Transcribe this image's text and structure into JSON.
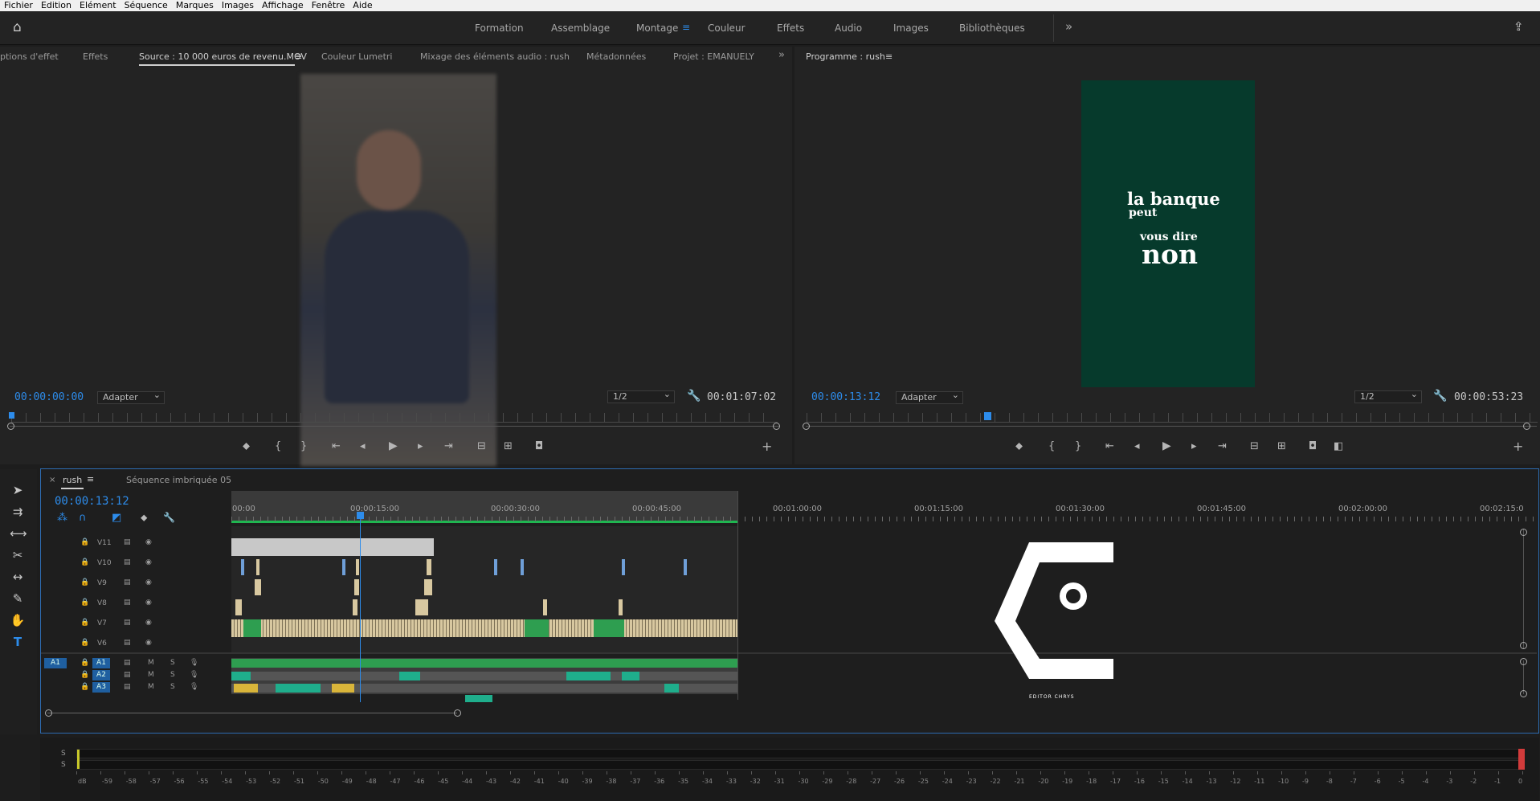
{
  "menu": [
    "Fichier",
    "Edition",
    "Elément",
    "Séquence",
    "Marques",
    "Images",
    "Affichage",
    "Fenêtre",
    "Aide"
  ],
  "workspaces": {
    "items": [
      "Formation",
      "Assemblage",
      "Montage",
      "Couleur",
      "Effets",
      "Audio",
      "Images",
      "Bibliothèques"
    ],
    "active": "Montage",
    "more": "»"
  },
  "source_panel": {
    "tabs": [
      "ptions d'effet",
      "Effets",
      "Source : 10 000 euros de revenu.MOV",
      "Couleur Lumetri",
      "Mixage des éléments audio : rush",
      "Métadonnées",
      "Projet : EMANUELY"
    ],
    "timecode": "00:00:00:00",
    "fit": "Adapter",
    "resolution": "1/2",
    "duration": "00:01:07:02"
  },
  "program_panel": {
    "title": "Programme : rush",
    "timecode": "00:00:13:12",
    "fit": "Adapter",
    "resolution": "1/2",
    "duration": "00:00:53:23",
    "caption": {
      "line1": "la banque",
      "line2": "peut",
      "line3": "vous dire",
      "line4": "non"
    }
  },
  "timeline": {
    "tabs": [
      "rush",
      "Séquence imbriquée 05"
    ],
    "timecode": "00:00:13:12",
    "ruler": [
      "00:00",
      "00:00:15:00",
      "00:00:30:00",
      "00:00:45:00",
      "00:01:00:00",
      "00:01:15:00",
      "00:01:30:00",
      "00:01:45:00",
      "00:02:00:00",
      "00:02:15:0"
    ],
    "video_tracks": [
      "V11",
      "V10",
      "V9",
      "V8",
      "V7",
      "V6"
    ],
    "audio_tracks": [
      "A1",
      "A2",
      "A3"
    ],
    "source_patch": "A1",
    "mute": "M",
    "solo": "S"
  },
  "watermark": {
    "label": "EDITOR CHRYS"
  },
  "meter": {
    "solo": [
      "S",
      "S"
    ],
    "scale": [
      "dB",
      "-59",
      "-58",
      "-57",
      "-56",
      "-55",
      "-54",
      "-53",
      "-52",
      "-51",
      "-50",
      "-49",
      "-48",
      "-47",
      "-46",
      "-45",
      "-44",
      "-43",
      "-42",
      "-41",
      "-40",
      "-39",
      "-38",
      "-37",
      "-36",
      "-35",
      "-34",
      "-33",
      "-32",
      "-31",
      "-30",
      "-29",
      "-28",
      "-27",
      "-26",
      "-25",
      "-24",
      "-23",
      "-22",
      "-21",
      "-20",
      "-19",
      "-18",
      "-17",
      "-16",
      "-15",
      "-14",
      "-13",
      "-12",
      "-11",
      "-10",
      "-9",
      "-8",
      "-7",
      "-6",
      "-5",
      "-4",
      "-3",
      "-2",
      "-1",
      "0"
    ]
  },
  "colors": {
    "accent": "#2d8ceb",
    "program_bg": "#063a2c",
    "clip_tan": "#d8c8a0",
    "clip_green": "#2e9e50",
    "audio_teal": "#1fae8c"
  }
}
